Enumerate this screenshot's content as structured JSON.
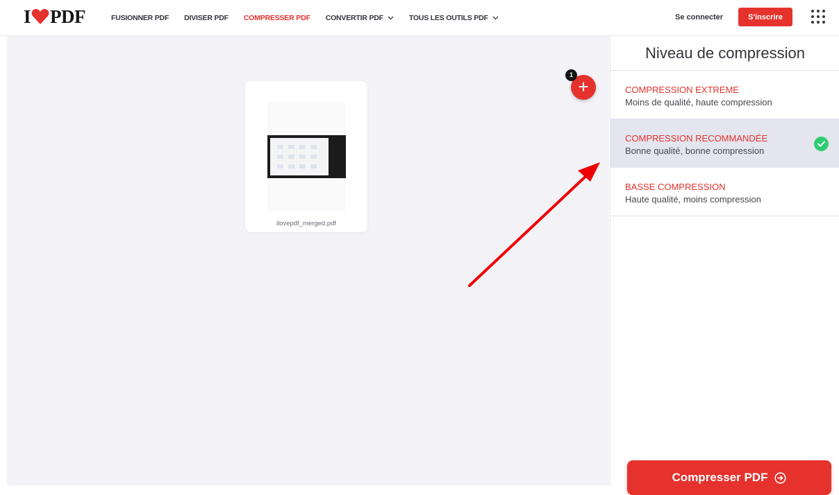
{
  "brand": {
    "left": "I",
    "right": "PDF",
    "accent": "#e5322d"
  },
  "nav": [
    {
      "label": "FUSIONNER PDF",
      "active": false,
      "dropdown": false
    },
    {
      "label": "DIVISER PDF",
      "active": false,
      "dropdown": false
    },
    {
      "label": "COMPRESSER PDF",
      "active": true,
      "dropdown": false
    },
    {
      "label": "CONVERTIR PDF",
      "active": false,
      "dropdown": true
    },
    {
      "label": "TOUS LES OUTILS PDF",
      "active": false,
      "dropdown": true
    }
  ],
  "header": {
    "login_label": "Se connecter",
    "signup_label": "S'inscrire"
  },
  "workspace": {
    "file_name": "ilovepdf_merged.pdf",
    "file_count": "1",
    "add_icon": "+"
  },
  "sidebar": {
    "title": "Niveau de compression",
    "options": [
      {
        "title": "COMPRESSION EXTREME",
        "desc": "Moins de qualité, haute compression",
        "selected": false
      },
      {
        "title": "COMPRESSION RECOMMANDÉE",
        "desc": "Bonne qualité, bonne compression",
        "selected": true
      },
      {
        "title": "BASSE COMPRESSION",
        "desc": "Haute qualité, moins compression",
        "selected": false
      }
    ],
    "submit_label": "Compresser PDF"
  },
  "colors": {
    "accent": "#e5322d",
    "check": "#2ecc71",
    "workspace_bg": "#f2f2f7",
    "selected_bg": "#e5e5ef"
  }
}
